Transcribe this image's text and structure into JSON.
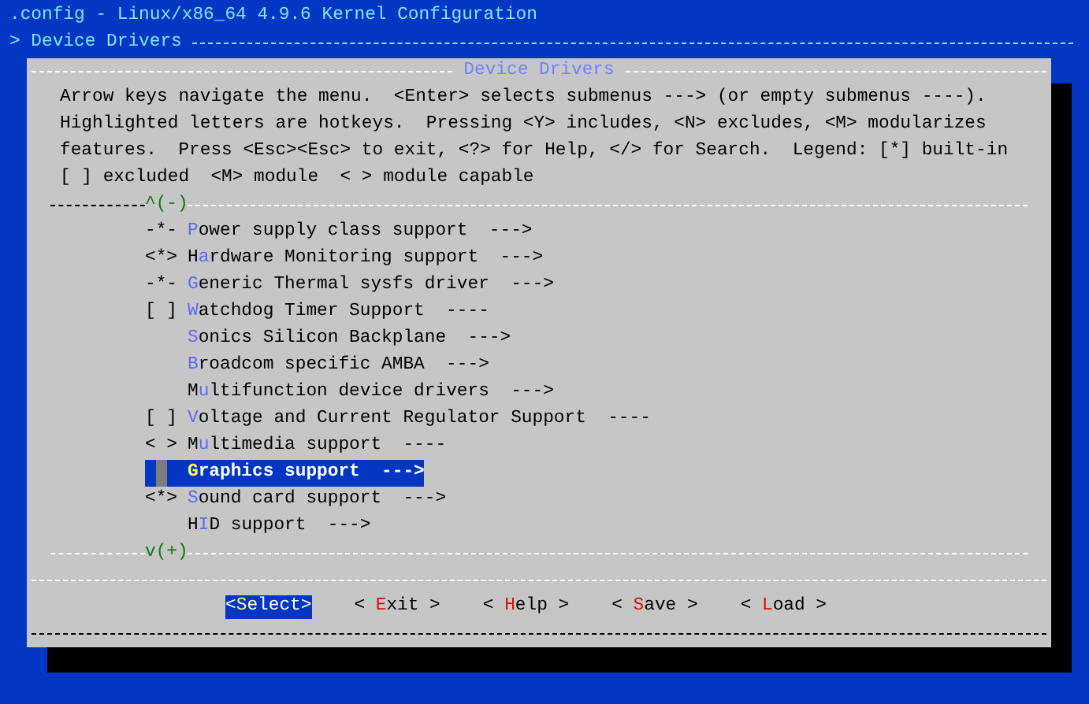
{
  "window": {
    "title": ".config - Linux/x86_64 4.9.6 Kernel Configuration"
  },
  "breadcrumb": "> Device Drivers",
  "dialog": {
    "title": "Device Drivers",
    "help": [
      "Arrow keys navigate the menu.  <Enter> selects submenus ---> (or empty submenus ----).",
      "Highlighted letters are hotkeys.  Pressing <Y> includes, <N> excludes, <M> modularizes",
      "features.  Press <Esc><Esc> to exit, <?> for Help, </> for Search.  Legend: [*] built-in",
      "[ ] excluded  <M> module  < > module capable"
    ],
    "scroll_up": "^(-)",
    "items": [
      {
        "prefix": "-*-",
        "label": "**P**ower supply class support  --->",
        "selected": false
      },
      {
        "prefix": "<*>",
        "label": "H**a**rdware Monitoring support  --->",
        "selected": false
      },
      {
        "prefix": "-*-",
        "label": "**G**eneric Thermal sysfs driver  --->",
        "selected": false
      },
      {
        "prefix": "[ ]",
        "label": "**W**atchdog Timer Support  ----",
        "selected": false
      },
      {
        "label": "**S**onics Silicon Backplane  --->",
        "selected": false
      },
      {
        "label": "**B**roadcom specific AMBA  --->",
        "selected": false
      },
      {
        "label": "M**u**ltifunction device drivers  --->",
        "selected": false
      },
      {
        "prefix": "[ ]",
        "label": "**V**oltage and Current Regulator Support  ----",
        "selected": false
      },
      {
        "prefix": "< >",
        "label": "M**u**ltimedia support  ----",
        "selected": false
      },
      {
        "label": "**G**raphics support  --->",
        "selected": true
      },
      {
        "prefix": "<*>",
        "label": "**S**ound card support  --->",
        "selected": false
      },
      {
        "label": "H**I**D support  --->",
        "selected": false
      }
    ],
    "scroll_down": "v(+)",
    "buttons": [
      {
        "label": "<**S**elect>",
        "selected": true
      },
      {
        "label": "< **E**xit >",
        "selected": false
      },
      {
        "label": "< **H**elp >",
        "selected": false
      },
      {
        "label": "< **S**ave >",
        "selected": false
      },
      {
        "label": "< **L**oad >",
        "selected": false
      }
    ]
  }
}
